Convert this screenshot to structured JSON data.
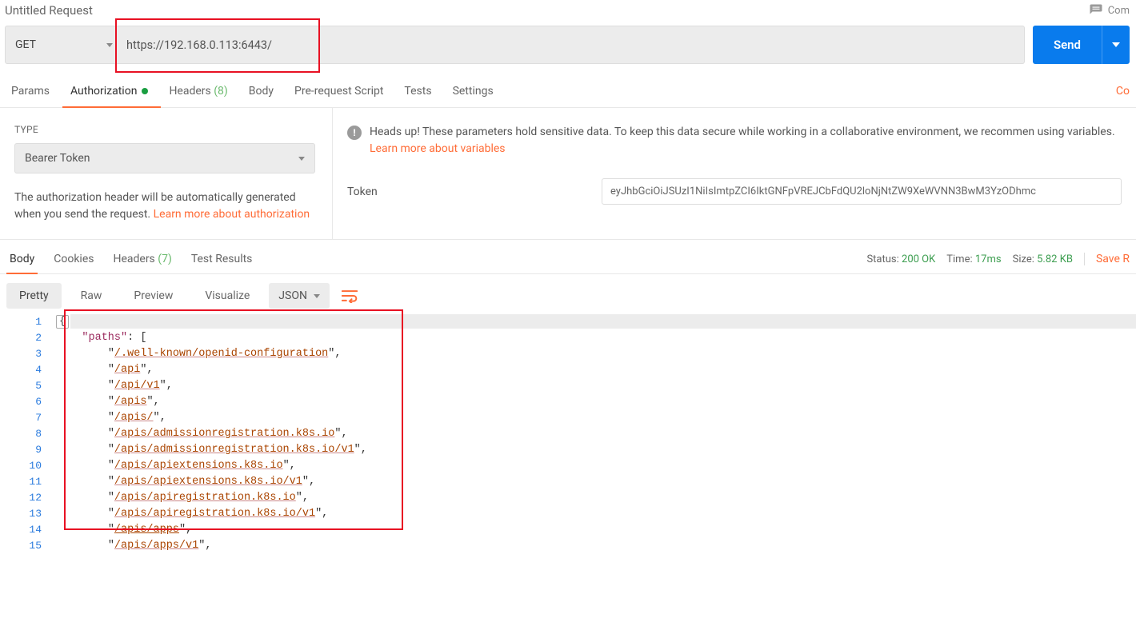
{
  "title": "Untitled Request",
  "comment_label": "Com",
  "method": "GET",
  "url": "https://192.168.0.113:6443/",
  "send_label": "Send",
  "req_tabs": {
    "params": "Params",
    "authorization": "Authorization",
    "headers": "Headers",
    "headers_count": "(8)",
    "body": "Body",
    "pre_request": "Pre-request Script",
    "tests": "Tests",
    "settings": "Settings",
    "right_link": "Co"
  },
  "auth": {
    "type_label": "TYPE",
    "type_value": "Bearer Token",
    "help_pre": "The authorization header will be automatically generated when you send the request. ",
    "help_link": "Learn more about authorization",
    "heads_up": "Heads up! These parameters hold sensitive data. To keep this data secure while working in a collaborative environment, we recommen using variables. ",
    "heads_up_link": "Learn more about variables",
    "token_label": "Token",
    "token_value": "eyJhbGciOiJSUzI1NiIsImtpZCI6IktGNFpVREJCbFdQU2loNjNtZW9XeWVNN3BwM3YzODhmc"
  },
  "resp": {
    "tabs": {
      "body": "Body",
      "cookies": "Cookies",
      "headers": "Headers",
      "headers_count": "(7)",
      "test_results": "Test Results"
    },
    "status_label": "Status:",
    "status_value": "200 OK",
    "time_label": "Time:",
    "time_value": "17ms",
    "size_label": "Size:",
    "size_value": "5.82 KB",
    "save": "Save R"
  },
  "view": {
    "pretty": "Pretty",
    "raw": "Raw",
    "preview": "Preview",
    "visualize": "Visualize",
    "lang": "JSON"
  },
  "code": {
    "key_paths": "\"paths\"",
    "lines": [
      {
        "n": 1,
        "raw": "{"
      },
      {
        "n": 2,
        "raw": "    \"paths\": ["
      },
      {
        "n": 3,
        "str": "/.well-known/openid-configuration"
      },
      {
        "n": 4,
        "str": "/api"
      },
      {
        "n": 5,
        "str": "/api/v1"
      },
      {
        "n": 6,
        "str": "/apis"
      },
      {
        "n": 7,
        "str": "/apis/"
      },
      {
        "n": 8,
        "str": "/apis/admissionregistration.k8s.io"
      },
      {
        "n": 9,
        "str": "/apis/admissionregistration.k8s.io/v1"
      },
      {
        "n": 10,
        "str": "/apis/apiextensions.k8s.io"
      },
      {
        "n": 11,
        "str": "/apis/apiextensions.k8s.io/v1"
      },
      {
        "n": 12,
        "str": "/apis/apiregistration.k8s.io"
      },
      {
        "n": 13,
        "str": "/apis/apiregistration.k8s.io/v1"
      },
      {
        "n": 14,
        "str": "/apis/apps"
      },
      {
        "n": 15,
        "str": "/apis/apps/v1"
      }
    ]
  }
}
